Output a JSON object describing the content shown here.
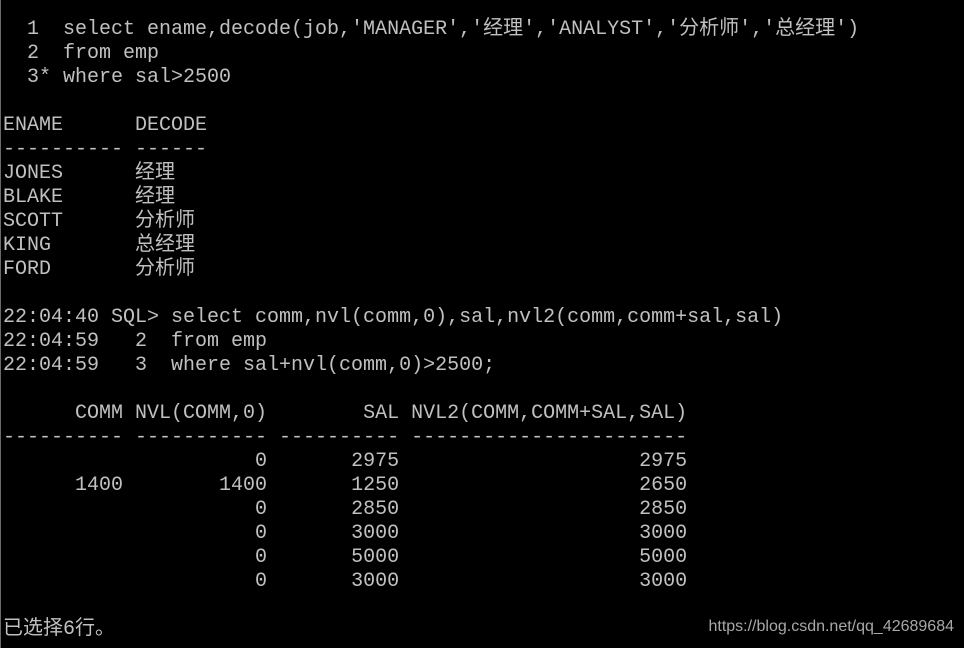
{
  "query1": {
    "lines": [
      "  1  select ename,decode(job,'MANAGER','经理','ANALYST','分析师','总经理')",
      "  2  from emp",
      "  3* where sal>2500"
    ]
  },
  "result1": {
    "headers": [
      "ENAME",
      "DECODE"
    ],
    "widths": [
      10,
      6
    ],
    "align": [
      "left",
      "left"
    ],
    "rows": [
      [
        "JONES",
        "经理"
      ],
      [
        "BLAKE",
        "经理"
      ],
      [
        "SCOTT",
        "分析师"
      ],
      [
        "KING",
        "总经理"
      ],
      [
        "FORD",
        "分析师"
      ]
    ]
  },
  "query2": {
    "lines": [
      "22:04:40 SQL> select comm,nvl(comm,0),sal,nvl2(comm,comm+sal,sal)",
      "22:04:59   2  from emp",
      "22:04:59   3  where sal+nvl(comm,0)>2500;"
    ]
  },
  "result2": {
    "headers": [
      "COMM",
      "NVL(COMM,0)",
      "SAL",
      "NVL2(COMM,COMM+SAL,SAL)"
    ],
    "widths": [
      10,
      11,
      10,
      23
    ],
    "align": [
      "right",
      "right",
      "right",
      "right"
    ],
    "rows": [
      [
        "",
        "0",
        "2975",
        "2975"
      ],
      [
        "1400",
        "1400",
        "1250",
        "2650"
      ],
      [
        "",
        "0",
        "2850",
        "2850"
      ],
      [
        "",
        "0",
        "3000",
        "3000"
      ],
      [
        "",
        "0",
        "5000",
        "5000"
      ],
      [
        "",
        "0",
        "3000",
        "3000"
      ]
    ]
  },
  "status": "已选择6行。",
  "watermark": "https://blog.csdn.net/qq_42689684",
  "colors": {
    "background": "#000000",
    "text": "#c0c0c0"
  }
}
